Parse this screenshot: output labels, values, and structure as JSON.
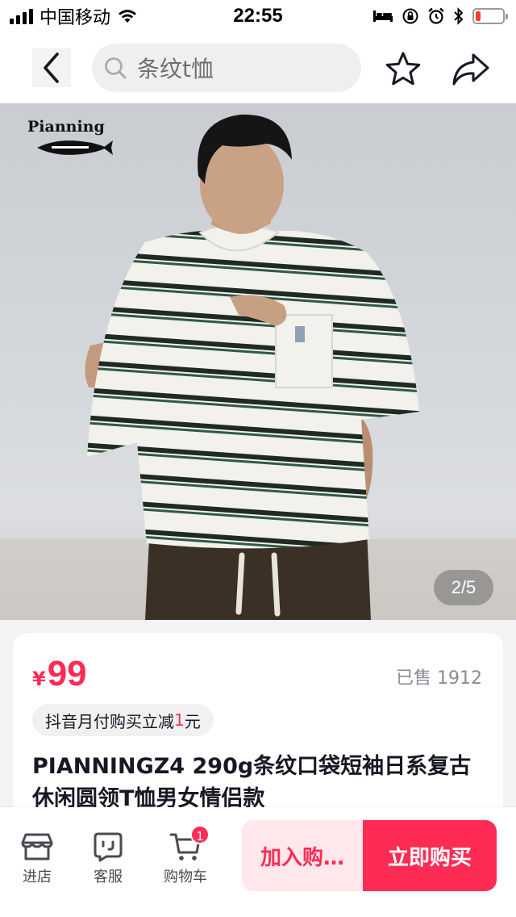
{
  "status_bar": {
    "carrier": "中国移动",
    "time": "22:55",
    "battery_level": 0.18,
    "battery_color": "#ff3b30"
  },
  "nav": {
    "back_icon": "chevron-left-icon",
    "search_icon": "search-icon",
    "search_text": "条纹t恤",
    "favorite_icon": "star-icon",
    "share_icon": "share-arrow-icon"
  },
  "hero": {
    "brand_logo_text": "Pianning",
    "page_indicator": "2/5"
  },
  "product": {
    "currency": "¥",
    "price": "99",
    "sold": "已售 1912",
    "promo_prefix": "抖音月付购买立减",
    "promo_amount": "1",
    "promo_suffix": "元",
    "title": "PIANNINGZ4  290g条纹口袋短袖日系复古休闲圆领T恤男女情侣款"
  },
  "bottom_bar": {
    "store_label": "进店",
    "service_label": "客服",
    "cart_label": "购物车",
    "cart_count": "1",
    "add_to_cart": "加入购…",
    "buy_now": "立即购买"
  },
  "colors": {
    "accent": "#fe2c55",
    "accent_light": "#ffe8ec",
    "text_primary": "#161823",
    "text_secondary": "#8a8b91"
  }
}
